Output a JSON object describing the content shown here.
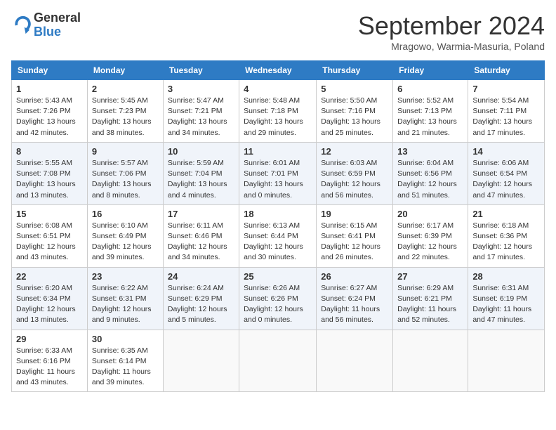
{
  "header": {
    "logo_general": "General",
    "logo_blue": "Blue",
    "title": "September 2024",
    "location": "Mragowo, Warmia-Masuria, Poland"
  },
  "weekdays": [
    "Sunday",
    "Monday",
    "Tuesday",
    "Wednesday",
    "Thursday",
    "Friday",
    "Saturday"
  ],
  "weeks": [
    [
      {
        "day": "1",
        "sunrise": "5:43 AM",
        "sunset": "7:26 PM",
        "daylight": "13 hours and 42 minutes."
      },
      {
        "day": "2",
        "sunrise": "5:45 AM",
        "sunset": "7:23 PM",
        "daylight": "13 hours and 38 minutes."
      },
      {
        "day": "3",
        "sunrise": "5:47 AM",
        "sunset": "7:21 PM",
        "daylight": "13 hours and 34 minutes."
      },
      {
        "day": "4",
        "sunrise": "5:48 AM",
        "sunset": "7:18 PM",
        "daylight": "13 hours and 29 minutes."
      },
      {
        "day": "5",
        "sunrise": "5:50 AM",
        "sunset": "7:16 PM",
        "daylight": "13 hours and 25 minutes."
      },
      {
        "day": "6",
        "sunrise": "5:52 AM",
        "sunset": "7:13 PM",
        "daylight": "13 hours and 21 minutes."
      },
      {
        "day": "7",
        "sunrise": "5:54 AM",
        "sunset": "7:11 PM",
        "daylight": "13 hours and 17 minutes."
      }
    ],
    [
      {
        "day": "8",
        "sunrise": "5:55 AM",
        "sunset": "7:08 PM",
        "daylight": "13 hours and 13 minutes."
      },
      {
        "day": "9",
        "sunrise": "5:57 AM",
        "sunset": "7:06 PM",
        "daylight": "13 hours and 8 minutes."
      },
      {
        "day": "10",
        "sunrise": "5:59 AM",
        "sunset": "7:04 PM",
        "daylight": "13 hours and 4 minutes."
      },
      {
        "day": "11",
        "sunrise": "6:01 AM",
        "sunset": "7:01 PM",
        "daylight": "13 hours and 0 minutes."
      },
      {
        "day": "12",
        "sunrise": "6:03 AM",
        "sunset": "6:59 PM",
        "daylight": "12 hours and 56 minutes."
      },
      {
        "day": "13",
        "sunrise": "6:04 AM",
        "sunset": "6:56 PM",
        "daylight": "12 hours and 51 minutes."
      },
      {
        "day": "14",
        "sunrise": "6:06 AM",
        "sunset": "6:54 PM",
        "daylight": "12 hours and 47 minutes."
      }
    ],
    [
      {
        "day": "15",
        "sunrise": "6:08 AM",
        "sunset": "6:51 PM",
        "daylight": "12 hours and 43 minutes."
      },
      {
        "day": "16",
        "sunrise": "6:10 AM",
        "sunset": "6:49 PM",
        "daylight": "12 hours and 39 minutes."
      },
      {
        "day": "17",
        "sunrise": "6:11 AM",
        "sunset": "6:46 PM",
        "daylight": "12 hours and 34 minutes."
      },
      {
        "day": "18",
        "sunrise": "6:13 AM",
        "sunset": "6:44 PM",
        "daylight": "12 hours and 30 minutes."
      },
      {
        "day": "19",
        "sunrise": "6:15 AM",
        "sunset": "6:41 PM",
        "daylight": "12 hours and 26 minutes."
      },
      {
        "day": "20",
        "sunrise": "6:17 AM",
        "sunset": "6:39 PM",
        "daylight": "12 hours and 22 minutes."
      },
      {
        "day": "21",
        "sunrise": "6:18 AM",
        "sunset": "6:36 PM",
        "daylight": "12 hours and 17 minutes."
      }
    ],
    [
      {
        "day": "22",
        "sunrise": "6:20 AM",
        "sunset": "6:34 PM",
        "daylight": "12 hours and 13 minutes."
      },
      {
        "day": "23",
        "sunrise": "6:22 AM",
        "sunset": "6:31 PM",
        "daylight": "12 hours and 9 minutes."
      },
      {
        "day": "24",
        "sunrise": "6:24 AM",
        "sunset": "6:29 PM",
        "daylight": "12 hours and 5 minutes."
      },
      {
        "day": "25",
        "sunrise": "6:26 AM",
        "sunset": "6:26 PM",
        "daylight": "12 hours and 0 minutes."
      },
      {
        "day": "26",
        "sunrise": "6:27 AM",
        "sunset": "6:24 PM",
        "daylight": "11 hours and 56 minutes."
      },
      {
        "day": "27",
        "sunrise": "6:29 AM",
        "sunset": "6:21 PM",
        "daylight": "11 hours and 52 minutes."
      },
      {
        "day": "28",
        "sunrise": "6:31 AM",
        "sunset": "6:19 PM",
        "daylight": "11 hours and 47 minutes."
      }
    ],
    [
      {
        "day": "29",
        "sunrise": "6:33 AM",
        "sunset": "6:16 PM",
        "daylight": "11 hours and 43 minutes."
      },
      {
        "day": "30",
        "sunrise": "6:35 AM",
        "sunset": "6:14 PM",
        "daylight": "11 hours and 39 minutes."
      },
      null,
      null,
      null,
      null,
      null
    ]
  ]
}
